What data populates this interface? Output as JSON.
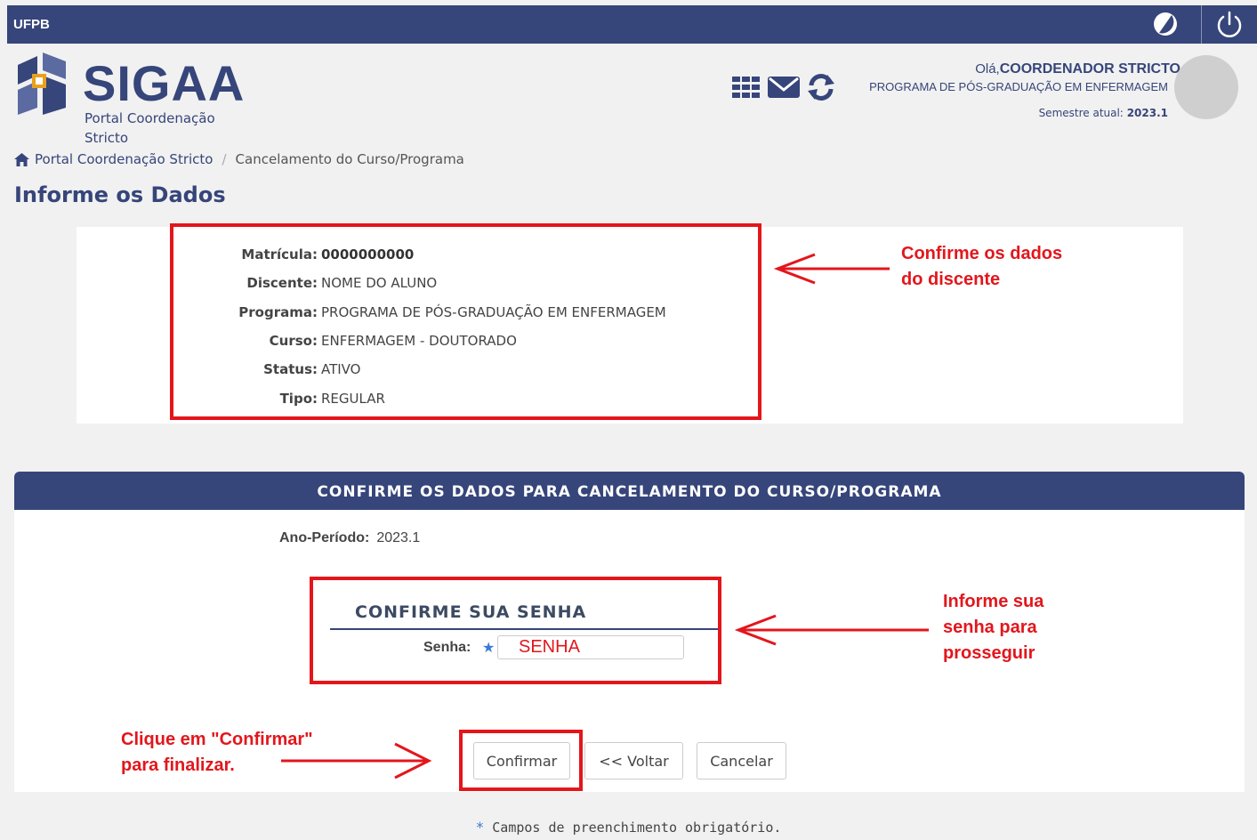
{
  "topbar": {
    "institution": "UFPB"
  },
  "header": {
    "logo_text": "SIGAA",
    "portal_subtitle": "Portal Coordenação Stricto",
    "greeting_prefix": "Olá,",
    "user_name": "COORDENADOR STRICTO",
    "program": "PROGRAMA DE PÓS-GRADUAÇÃO EM ENFERMAGEM",
    "semester_label": "Semestre atual:",
    "semester_value": "2023.1",
    "icons": [
      "apps-grid-icon",
      "mail-icon",
      "refresh-icon"
    ]
  },
  "breadcrumb": {
    "home": "Portal Coordenação Stricto",
    "separator": "/",
    "current": "Cancelamento do Curso/Programa"
  },
  "page_title": "Informe os Dados",
  "student": {
    "fields": [
      {
        "label": "Matrícula:",
        "value": "0000000000"
      },
      {
        "label": "Discente:",
        "value": "NOME DO ALUNO"
      },
      {
        "label": "Programa:",
        "value": "PROGRAMA DE PÓS-GRADUAÇÃO EM ENFERMAGEM"
      },
      {
        "label": "Curso:",
        "value": "ENFERMAGEM - DOUTORADO"
      },
      {
        "label": "Status:",
        "value": "ATIVO"
      },
      {
        "label": "Tipo:",
        "value": "REGULAR"
      }
    ]
  },
  "annotations": {
    "confirm_data": [
      "Confirme os dados",
      "do discente"
    ],
    "inform_password": [
      "Informe sua",
      "senha para",
      "prosseguir"
    ],
    "click_confirm": [
      "Clique em \"Confirmar\"",
      "para finalizar."
    ]
  },
  "form": {
    "header": "CONFIRME OS DADOS PARA CANCELAMENTO DO CURSO/PROGRAMA",
    "ano_periodo_label": "Ano-Período:",
    "ano_periodo_value": "2023.1",
    "password_title": "CONFIRME SUA SENHA",
    "senha_label": "Senha:",
    "senha_value": "SENHA",
    "buttons": {
      "confirm": "Confirmar",
      "back": "<< Voltar",
      "cancel": "Cancelar"
    }
  },
  "footnote": "Campos de preenchimento obrigatório.",
  "colors": {
    "primary": "#36457a",
    "annotation": "#e3161c",
    "required_star": "#3a7bd5"
  }
}
